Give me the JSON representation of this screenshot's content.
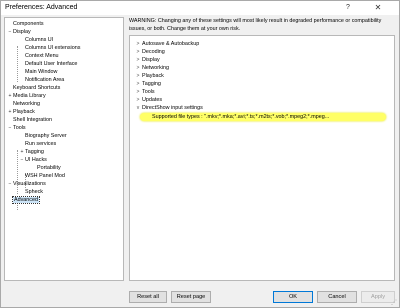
{
  "window": {
    "title": "Preferences: Advanced",
    "help_glyph": "?",
    "close_glyph": "✕"
  },
  "tree": {
    "items": [
      {
        "label": "Components",
        "toggle": ""
      },
      {
        "label": "Display",
        "toggle": "−"
      },
      {
        "label": "Columns UI",
        "toggle": ""
      },
      {
        "label": "Columns UI extensions",
        "toggle": ""
      },
      {
        "label": "Context Menu",
        "toggle": ""
      },
      {
        "label": "Default User Interface",
        "toggle": ""
      },
      {
        "label": "Main Window",
        "toggle": ""
      },
      {
        "label": "Notification Area",
        "toggle": ""
      },
      {
        "label": "Keyboard Shortcuts",
        "toggle": ""
      },
      {
        "label": "Media Library",
        "toggle": "+"
      },
      {
        "label": "Networking",
        "toggle": ""
      },
      {
        "label": "Playback",
        "toggle": "+"
      },
      {
        "label": "Shell Integration",
        "toggle": ""
      },
      {
        "label": "Tools",
        "toggle": "−"
      },
      {
        "label": "Biography Server",
        "toggle": ""
      },
      {
        "label": "Run services",
        "toggle": ""
      },
      {
        "label": "Tagging",
        "toggle": "+"
      },
      {
        "label": "UI Hacks",
        "toggle": "−"
      },
      {
        "label": "Portability",
        "toggle": ""
      },
      {
        "label": "WSH Panel Mod",
        "toggle": ""
      },
      {
        "label": "Visualizations",
        "toggle": "−"
      },
      {
        "label": "Spheck",
        "toggle": ""
      },
      {
        "label": "Advanced",
        "toggle": ""
      }
    ]
  },
  "warning": "WARNING: Changing any of these settings will most likely result in degraded performance or compatibility issues, or both. Change them at your own risk.",
  "settings": {
    "items": [
      {
        "label": "Autosave & Autobackup",
        "chevron": ">"
      },
      {
        "label": "Decoding",
        "chevron": ">"
      },
      {
        "label": "Display",
        "chevron": ">"
      },
      {
        "label": "Networking",
        "chevron": ">"
      },
      {
        "label": "Playback",
        "chevron": ">"
      },
      {
        "label": "Tagging",
        "chevron": ">"
      },
      {
        "label": "Tools",
        "chevron": ">"
      },
      {
        "label": "Updates",
        "chevron": ">"
      },
      {
        "label": "DirectShow input settings",
        "chevron": "v"
      }
    ],
    "sub_item": "Supported file types : \".mkv;*.mka;*.avi;*.ts;*.m2ts;*.vob;*.mpeg2;*.mpeg..."
  },
  "buttons": {
    "reset_all": "Reset all",
    "reset_page": "Reset page",
    "ok": "OK",
    "cancel": "Cancel",
    "apply": "Apply"
  }
}
